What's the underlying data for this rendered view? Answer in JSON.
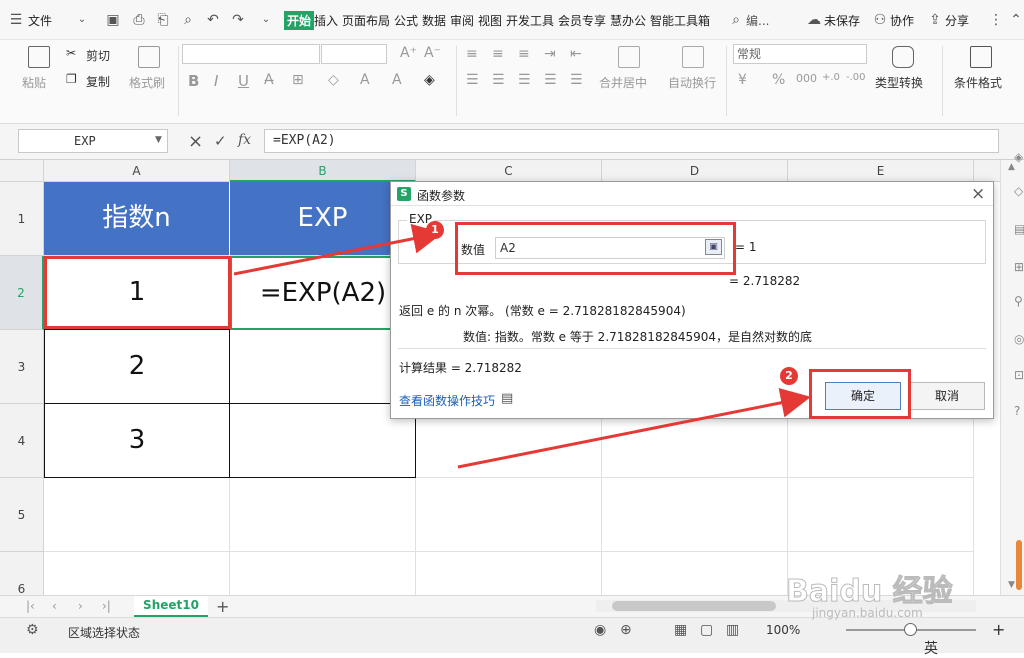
{
  "menubar": {
    "file_label": "文件",
    "tabs": [
      "开始",
      "插入",
      "页面布局",
      "公式",
      "数据",
      "审阅",
      "视图",
      "开发工具",
      "会员专享",
      "慧办公",
      "智能工具箱"
    ],
    "search_label": "编...",
    "unsaved_label": "未保存",
    "collab_label": "协作",
    "share_label": "分享"
  },
  "ribbon": {
    "paste_label": "粘贴",
    "cut_label": "剪切",
    "copy_label": "复制",
    "format_painter_label": "格式刷",
    "merge_label": "合并居中",
    "wrap_label": "自动换行",
    "number_format_value": "常规",
    "type_convert_label": "类型转换",
    "cond_format_label": "条件格式",
    "bold": "B",
    "italic": "I",
    "underline": "U",
    "currency": "¥",
    "percent": "%"
  },
  "formula_bar": {
    "name_box": "EXP",
    "cancel": "×",
    "confirm": "✓",
    "fx": "fx",
    "formula": "=EXP(A2)"
  },
  "grid": {
    "columns": [
      "A",
      "B",
      "C",
      "D",
      "E"
    ],
    "rows": [
      "1",
      "2",
      "3",
      "4",
      "5",
      "6"
    ],
    "header_a": "指数n",
    "header_b": "EXP",
    "values_a": [
      "1",
      "2",
      "3"
    ],
    "b2_value": "=EXP(A2)"
  },
  "sheet_tabs": {
    "active": "Sheet10",
    "add": "+"
  },
  "statusbar": {
    "status_text": "区域选择状态",
    "zoom": "100%",
    "lang": "英"
  },
  "dialog": {
    "title": "函数参数",
    "group_label": "EXP",
    "arg_label": "数值",
    "arg_value": "A2",
    "arg_result": "= 1",
    "func_result": "= 2.718282",
    "description": "返回 e 的 n 次幂。 (常数 e = 2.71828182845904)",
    "arg_description": "数值:  指数。常数 e 等于 2.71828182845904，是自然对数的底",
    "calc_result": "计算结果 =  2.718282",
    "help_link": "查看函数操作技巧",
    "ok_label": "确定",
    "cancel_label": "取消",
    "close": "×"
  },
  "annotations": {
    "badge1": "1",
    "badge2": "2",
    "highlight_color": "#e53935"
  },
  "watermark": {
    "main": "Baidu 经验",
    "sub": "jingyan.baidu.com"
  },
  "colors": {
    "accent_green": "#25a266",
    "header_blue": "#4472c4"
  }
}
